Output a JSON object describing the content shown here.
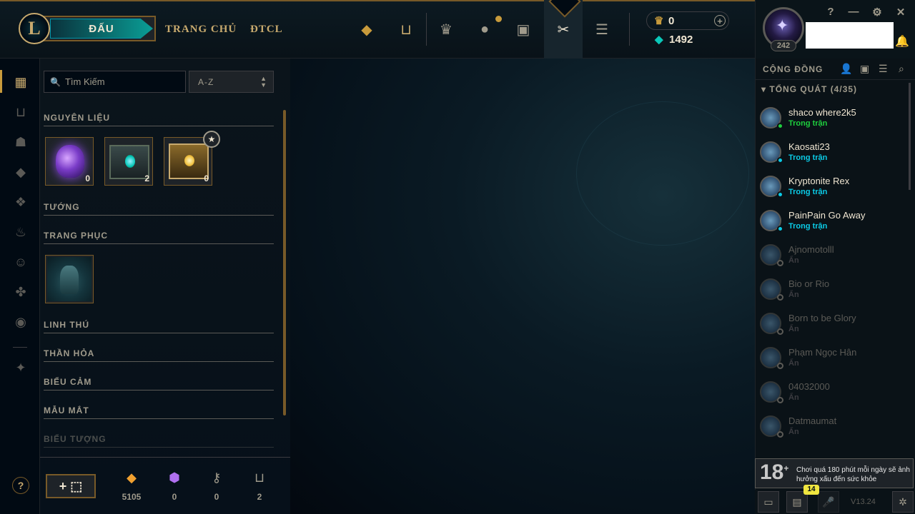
{
  "topbar": {
    "logo_letter": "L",
    "play_label": "ĐẤU",
    "nav_home": "TRANG CHỦ",
    "nav_tft": "ĐTCL",
    "rp_value": "0",
    "be_value": "1492",
    "plus": "+"
  },
  "profile": {
    "level": "242"
  },
  "window": {
    "help": "?",
    "minimize": "—",
    "settings": "⚙",
    "close": "✕"
  },
  "inventory": {
    "search_placeholder": "Tìm Kiếm",
    "sort_value": "A-Z",
    "sections": {
      "materials": "NGUYÊN LIỆU",
      "champions": "TƯỚNG",
      "skins": "TRANG PHỤC",
      "companions": "LINH THÚ",
      "icons": "THẦN HỎA",
      "emotes": "BIỂU CẢM",
      "wards": "MẪU MẮT",
      "profile_icons": "BIỂU TƯỢNG"
    },
    "materials": [
      {
        "count": "0",
        "icon": "orb-icon"
      },
      {
        "count": "2",
        "icon": "hextech-chest-icon"
      },
      {
        "count": "0",
        "icon": "masterwork-chest-icon"
      }
    ],
    "bottom": {
      "craft_label": "+ ⬚",
      "orange_essence": "5105",
      "mythic_essence": "0",
      "keys": "0",
      "chests": "2"
    }
  },
  "social": {
    "title": "CỘNG ĐỒNG",
    "group": "TỔNG QUÁT (4/35)",
    "friends": [
      {
        "name": "shaco where2k5",
        "status": "Trong trận",
        "status_color": "#1ecf3e",
        "online": true
      },
      {
        "name": "Kaosati23",
        "status": "Trong trận",
        "status_color": "#0acbe6",
        "online": true
      },
      {
        "name": "Kryptonite Rex",
        "status": "Trong trận",
        "status_color": "#0acbe6",
        "online": true
      },
      {
        "name": "PainPain Go Away",
        "status": "Trong trận",
        "status_color": "#0acbe6",
        "online": true
      },
      {
        "name": "Ajnomotolll",
        "status": "Ẩn",
        "online": false
      },
      {
        "name": "Bio or Rio",
        "status": "Ẩn",
        "online": false
      },
      {
        "name": "Born to be Glory",
        "status": "Ẩn",
        "online": false
      },
      {
        "name": "Phạm Ngọc Hân",
        "status": "Ẩn",
        "online": false
      },
      {
        "name": "04032000",
        "status": "Ẩn",
        "online": false
      },
      {
        "name": "Datmaumat",
        "status": "Ẩn",
        "online": false
      }
    ],
    "warning_age": "18",
    "warning_text": "Chơi quá 180 phút mỗi ngày sẽ ảnh hưởng xấu đến sức khỏe",
    "notif_count": "14",
    "version": "V13.24"
  }
}
